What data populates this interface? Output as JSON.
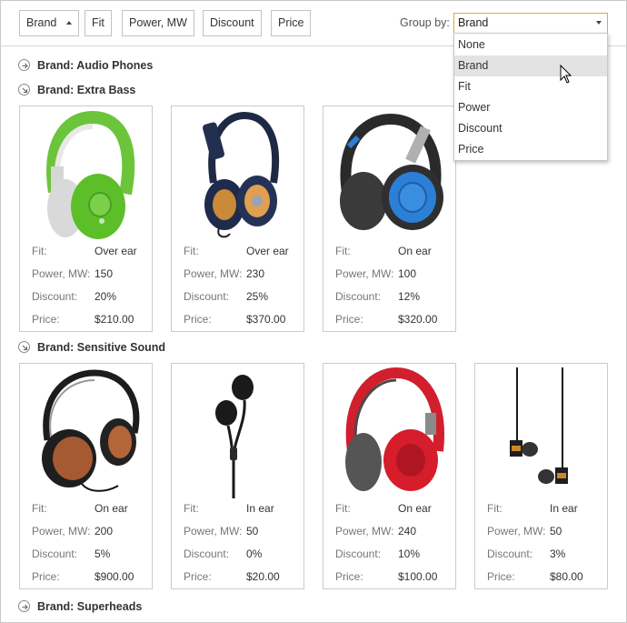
{
  "toolbar": {
    "sort_buttons": [
      "Brand",
      "Fit",
      "Power, MW",
      "Discount",
      "Price"
    ],
    "group_by_label": "Group by:",
    "group_by_value": "Brand",
    "group_by_options": [
      "None",
      "Brand",
      "Fit",
      "Power",
      "Discount",
      "Price"
    ],
    "accent_color": "#e8a33c"
  },
  "spec_labels": {
    "fit": "Fit:",
    "power": "Power, MW:",
    "discount": "Discount:",
    "price": "Price:"
  },
  "groups": [
    {
      "title": "Brand: Audio Phones",
      "expanded": false
    },
    {
      "title": "Brand: Extra Bass",
      "expanded": true,
      "products": [
        {
          "image": "headphones-green-white",
          "fit": "Over ear",
          "power": "150",
          "discount": "20%",
          "price": "$210.00"
        },
        {
          "image": "headphones-navy-orange",
          "fit": "Over ear",
          "power": "230",
          "discount": "25%",
          "price": "$370.00"
        },
        {
          "image": "headphones-black-blue",
          "fit": "On ear",
          "power": "100",
          "discount": "12%",
          "price": "$320.00"
        }
      ]
    },
    {
      "title": "Brand: Sensitive Sound",
      "expanded": true,
      "products": [
        {
          "image": "headphones-black-wood",
          "fit": "On ear",
          "power": "200",
          "discount": "5%",
          "price": "$900.00"
        },
        {
          "image": "earbuds-black",
          "fit": "In ear",
          "power": "50",
          "discount": "0%",
          "price": "$20.00"
        },
        {
          "image": "headphones-red-grey",
          "fit": "On ear",
          "power": "240",
          "discount": "10%",
          "price": "$100.00"
        },
        {
          "image": "earbuds-gold-black",
          "fit": "In ear",
          "power": "50",
          "discount": "3%",
          "price": "$80.00"
        }
      ]
    },
    {
      "title": "Brand: Superheads",
      "expanded": false
    }
  ]
}
